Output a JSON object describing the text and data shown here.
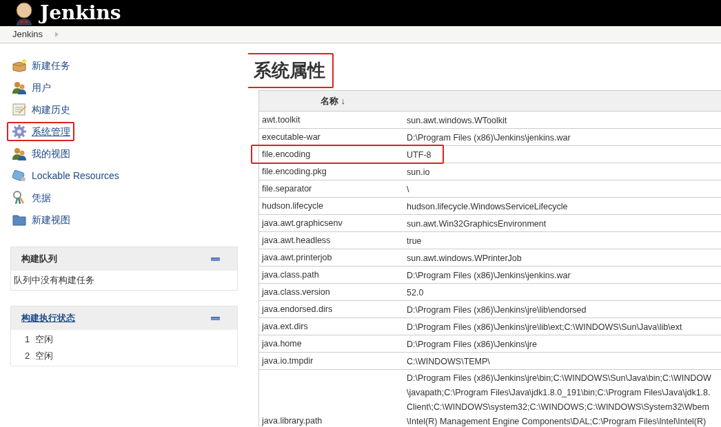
{
  "header": {
    "title": "Jenkins"
  },
  "breadcrumb": [
    {
      "label": "Jenkins"
    }
  ],
  "sidebar": {
    "items": [
      {
        "label": "新建任务",
        "highlighted": false
      },
      {
        "label": "用户",
        "highlighted": false
      },
      {
        "label": "构建历史",
        "highlighted": false
      },
      {
        "label": "系统管理",
        "highlighted": true
      },
      {
        "label": "我的视图",
        "highlighted": false
      },
      {
        "label": "Lockable Resources",
        "highlighted": false
      },
      {
        "label": "凭据",
        "highlighted": false
      },
      {
        "label": "新建视图",
        "highlighted": false
      }
    ]
  },
  "build_queue": {
    "title": "构建队列",
    "link": false,
    "lines": [
      {
        "text": "队列中没有构建任务"
      }
    ]
  },
  "executors": {
    "title": "构建执行状态",
    "link": true,
    "lines": [
      {
        "number": "1",
        "text": "空闲"
      },
      {
        "number": "2",
        "text": "空闲"
      }
    ]
  },
  "main": {
    "heading": "系统属性",
    "heading_highlighted": true,
    "table": {
      "columns": [
        "名称 ↓"
      ],
      "rows": [
        {
          "name": "awt.toolkit",
          "value": [
            "sun.awt.windows.WToolkit"
          ],
          "highlighted": false
        },
        {
          "name": "executable-war",
          "value": [
            "D:\\Program Files (x86)\\Jenkins\\jenkins.war"
          ],
          "highlighted": false
        },
        {
          "name": "file.encoding",
          "value": [
            "UTF-8"
          ],
          "highlighted": true
        },
        {
          "name": "file.encoding.pkg",
          "value": [
            "sun.io"
          ],
          "highlighted": false
        },
        {
          "name": "file.separator",
          "value": [
            "\\"
          ],
          "highlighted": false
        },
        {
          "name": "hudson.lifecycle",
          "value": [
            "hudson.lifecycle.WindowsServiceLifecycle"
          ],
          "highlighted": false
        },
        {
          "name": "java.awt.graphicsenv",
          "value": [
            "sun.awt.Win32GraphicsEnvironment"
          ],
          "highlighted": false
        },
        {
          "name": "java.awt.headless",
          "value": [
            "true"
          ],
          "highlighted": false
        },
        {
          "name": "java.awt.printerjob",
          "value": [
            "sun.awt.windows.WPrinterJob"
          ],
          "highlighted": false
        },
        {
          "name": "java.class.path",
          "value": [
            "D:\\Program Files (x86)\\Jenkins\\jenkins.war"
          ],
          "highlighted": false
        },
        {
          "name": "java.class.version",
          "value": [
            "52.0"
          ],
          "highlighted": false
        },
        {
          "name": "java.endorsed.dirs",
          "value": [
            "D:\\Program Files (x86)\\Jenkins\\jre\\lib\\endorsed"
          ],
          "highlighted": false
        },
        {
          "name": "java.ext.dirs",
          "value": [
            "D:\\Program Files (x86)\\Jenkins\\jre\\lib\\ext;C:\\WINDOWS\\Sun\\Java\\lib\\ext"
          ],
          "highlighted": false
        },
        {
          "name": "java.home",
          "value": [
            "D:\\Program Files (x86)\\Jenkins\\jre"
          ],
          "highlighted": false
        },
        {
          "name": "java.io.tmpdir",
          "value": [
            "C:\\WINDOWS\\TEMP\\"
          ],
          "highlighted": false
        },
        {
          "name": "java.library.path",
          "value": [
            "D:\\Program Files (x86)\\Jenkins\\jre\\bin;C:\\WINDOWS\\Sun\\Java\\bin;C:\\WINDOW",
            "\\javapath;C:\\Program Files\\Java\\jdk1.8.0_191\\bin;C:\\Program Files\\Java\\jdk1.8.",
            "Client\\;C:\\WINDOWS\\system32;C:\\WINDOWS;C:\\WINDOWS\\System32\\Wbem",
            "\\Intel(R) Management Engine Components\\DAL;C:\\Program Files\\Intel\\Intel(R)"
          ],
          "highlighted": false
        }
      ]
    }
  }
}
